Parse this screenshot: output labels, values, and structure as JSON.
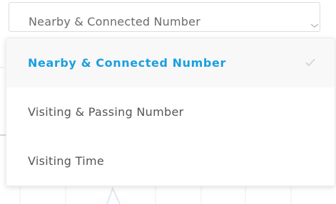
{
  "dropdown": {
    "current_value": "Nearby & Connected Number",
    "chevron_icon": "chevron-down-icon",
    "options": [
      {
        "label": "Nearby & Connected Number",
        "selected": true,
        "icon": "check-icon"
      },
      {
        "label": "Visiting & Passing Number",
        "selected": false
      },
      {
        "label": "Visiting Time",
        "selected": false
      }
    ]
  },
  "colors": {
    "selected_text": "#1a9fe0",
    "option_text": "#555555",
    "value_text": "#6b6b6b",
    "check_mark": "#d0d0d0",
    "border": "#dcdcdc"
  }
}
